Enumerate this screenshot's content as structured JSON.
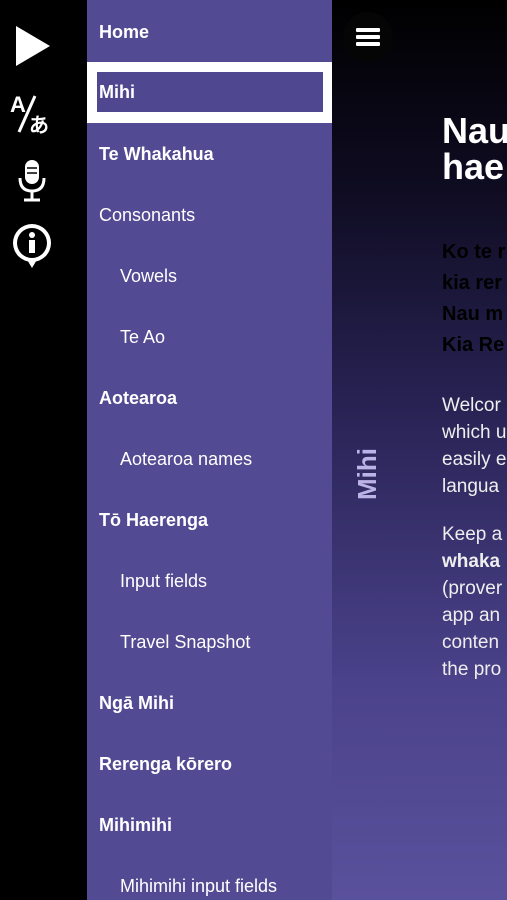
{
  "sidebar": {
    "icons": [
      "play-icon",
      "translate-icon",
      "microphone-icon",
      "info-icon"
    ]
  },
  "menu": {
    "items": [
      {
        "label": "Home",
        "bold": true,
        "level": 0
      },
      {
        "label": "Mihi",
        "bold": true,
        "level": 0,
        "selected": true
      },
      {
        "label": "Te Whakahua",
        "bold": true,
        "level": 0
      },
      {
        "label": "Consonants",
        "bold": false,
        "level": 0
      },
      {
        "label": "Vowels",
        "bold": false,
        "level": 1
      },
      {
        "label": "Te Ao",
        "bold": false,
        "level": 1
      },
      {
        "label": "Aotearoa",
        "bold": true,
        "level": 0
      },
      {
        "label": "Aotearoa names",
        "bold": false,
        "level": 1
      },
      {
        "label": "Tō Haerenga",
        "bold": true,
        "level": 0
      },
      {
        "label": "Input fields",
        "bold": false,
        "level": 1
      },
      {
        "label": "Travel Snapshot",
        "bold": false,
        "level": 1
      },
      {
        "label": "Ngā Mihi",
        "bold": true,
        "level": 0
      },
      {
        "label": "Rerenga kōrero",
        "bold": true,
        "level": 0
      },
      {
        "label": "Mihimihi",
        "bold": true,
        "level": 0
      },
      {
        "label": "Mihimihi input fields",
        "bold": false,
        "level": 1
      }
    ]
  },
  "content": {
    "section_label": "Mihi",
    "heading_lines": [
      "Nau",
      "hae"
    ],
    "bold_lines": [
      "Ko te r",
      "kia rer",
      "Nau m",
      "Kia Re"
    ],
    "para1_lines": [
      "Welcor",
      "which u",
      "easily e",
      "langua"
    ],
    "para2_lines": [
      "Keep a",
      "whaka",
      "(prover",
      "app an",
      "conten",
      "the pro"
    ]
  },
  "colors": {
    "menu_bg": "#524a92",
    "accent": "#bcb4e6"
  }
}
